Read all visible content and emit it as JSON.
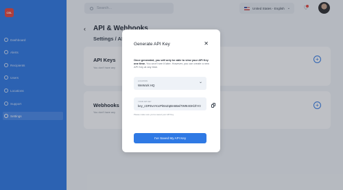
{
  "app": {
    "logo_text": "CBL"
  },
  "sidebar": {
    "items": [
      {
        "label": "Dashboard",
        "icon": "dashboard-icon"
      },
      {
        "label": "Alerts",
        "icon": "alert-icon"
      },
      {
        "label": "Recipients",
        "icon": "recipients-icon"
      },
      {
        "label": "Users",
        "icon": "users-icon"
      },
      {
        "label": "Locations",
        "icon": "location-icon"
      },
      {
        "label": "Support",
        "icon": "support-icon"
      },
      {
        "label": "Settings",
        "icon": "gear-icon",
        "active": true
      }
    ]
  },
  "header": {
    "search_placeholder": "Search...",
    "language": "United States - English"
  },
  "page": {
    "title": "API & Webhooks",
    "breadcrumb": "Settings / API",
    "sections": [
      {
        "title": "API Keys",
        "subtitle": "You don't have any"
      },
      {
        "title": "Webhooks",
        "subtitle": "You don't have any"
      }
    ]
  },
  "modal": {
    "title": "Generate API Key",
    "desc_bold": "Once generated, you will only be able to view your API Key one time.",
    "desc_rest": " You won't see it later. However, you can create a new API Key at any time.",
    "location_label": "LOCATION",
    "location_value": "WeWork HQ",
    "key_label": "YOUR API KEY",
    "key_value": "key_cDFEvnYocPk5nZqBn6Bwl7W9I4GKlzhYz",
    "hint": "Please make sure you've saved your API Key",
    "save_label": "I've Saved My API Key"
  },
  "colors": {
    "accent": "#2f79e4",
    "notification": "#e8453c"
  }
}
